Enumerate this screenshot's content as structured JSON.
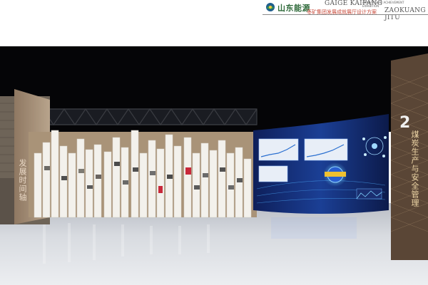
{
  "header": {
    "brand_cn": "山东能源",
    "brand_en_line1": "GAIGE KAIFANG",
    "brand_en_line1_small": "ANNIVERSARY ACHIEVEMENT EXHIBITION",
    "brand_en_line2": "ZAOKUANG JITU",
    "subtitle": "枣矿集团发展成就展厅设计方案"
  },
  "scene": {
    "left_wall_title": "发展时间轴",
    "tower_number": "2",
    "tower_title": "煤炭生产与安全管理"
  },
  "colors": {
    "ceiling": "#050507",
    "floor": "#d9dce0",
    "wall_beige": "#a99378",
    "screen_blue": "#1a3a8c",
    "logo_green": "#2f6a3a"
  }
}
